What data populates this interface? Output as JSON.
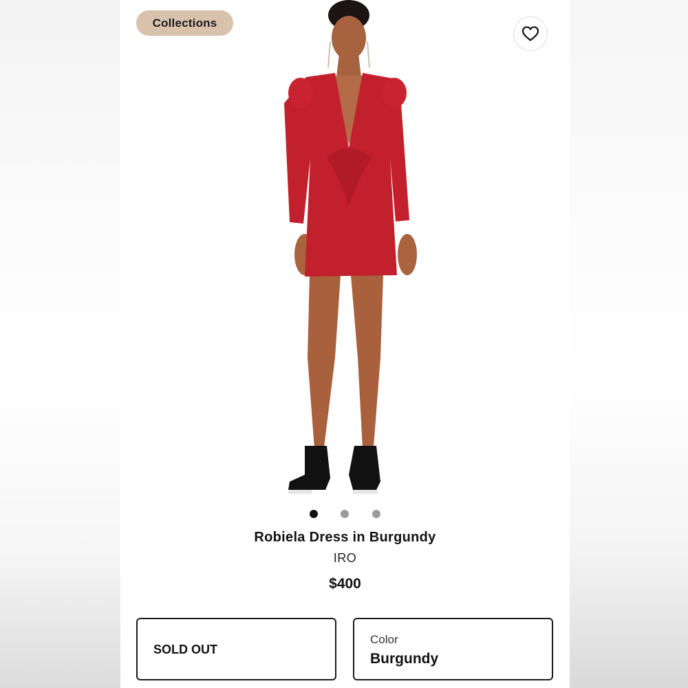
{
  "header": {
    "collections_label": "Collections",
    "favorite_icon": "heart-icon"
  },
  "gallery": {
    "image_alt": "Model wearing red long-sleeve deep V mini dress with black heeled sandals",
    "dots": [
      {
        "state": "active"
      },
      {
        "state": "inactive"
      },
      {
        "state": "inactive"
      }
    ]
  },
  "product": {
    "name": "Robiela Dress in Burgundy",
    "brand": "IRO",
    "price": "$400"
  },
  "options": {
    "availability": "SOLD OUT",
    "color_label": "Color",
    "color_value": "Burgundy"
  },
  "colors": {
    "chip_bg": "#d9c2ac",
    "dress": "#c2202c",
    "active_dot": "#111111",
    "inactive_dot": "#9a9a9a"
  }
}
